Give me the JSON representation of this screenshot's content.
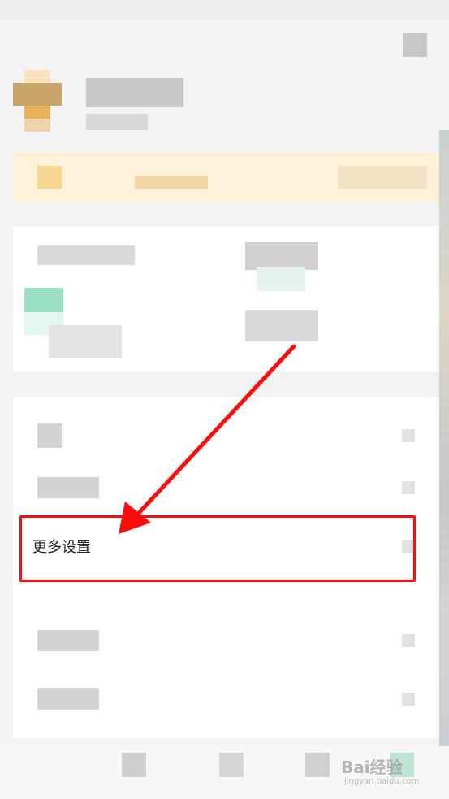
{
  "menu": {
    "more_settings_label": "更多设置"
  },
  "colors": {
    "highlight": "#ff0c0c",
    "arrow": "#ff0c0c",
    "card_background": "#ffffff",
    "vip_banner": "#fdf1d8"
  },
  "watermark": {
    "brand": "Bai经验",
    "url": "jingyan.baidu.com"
  }
}
